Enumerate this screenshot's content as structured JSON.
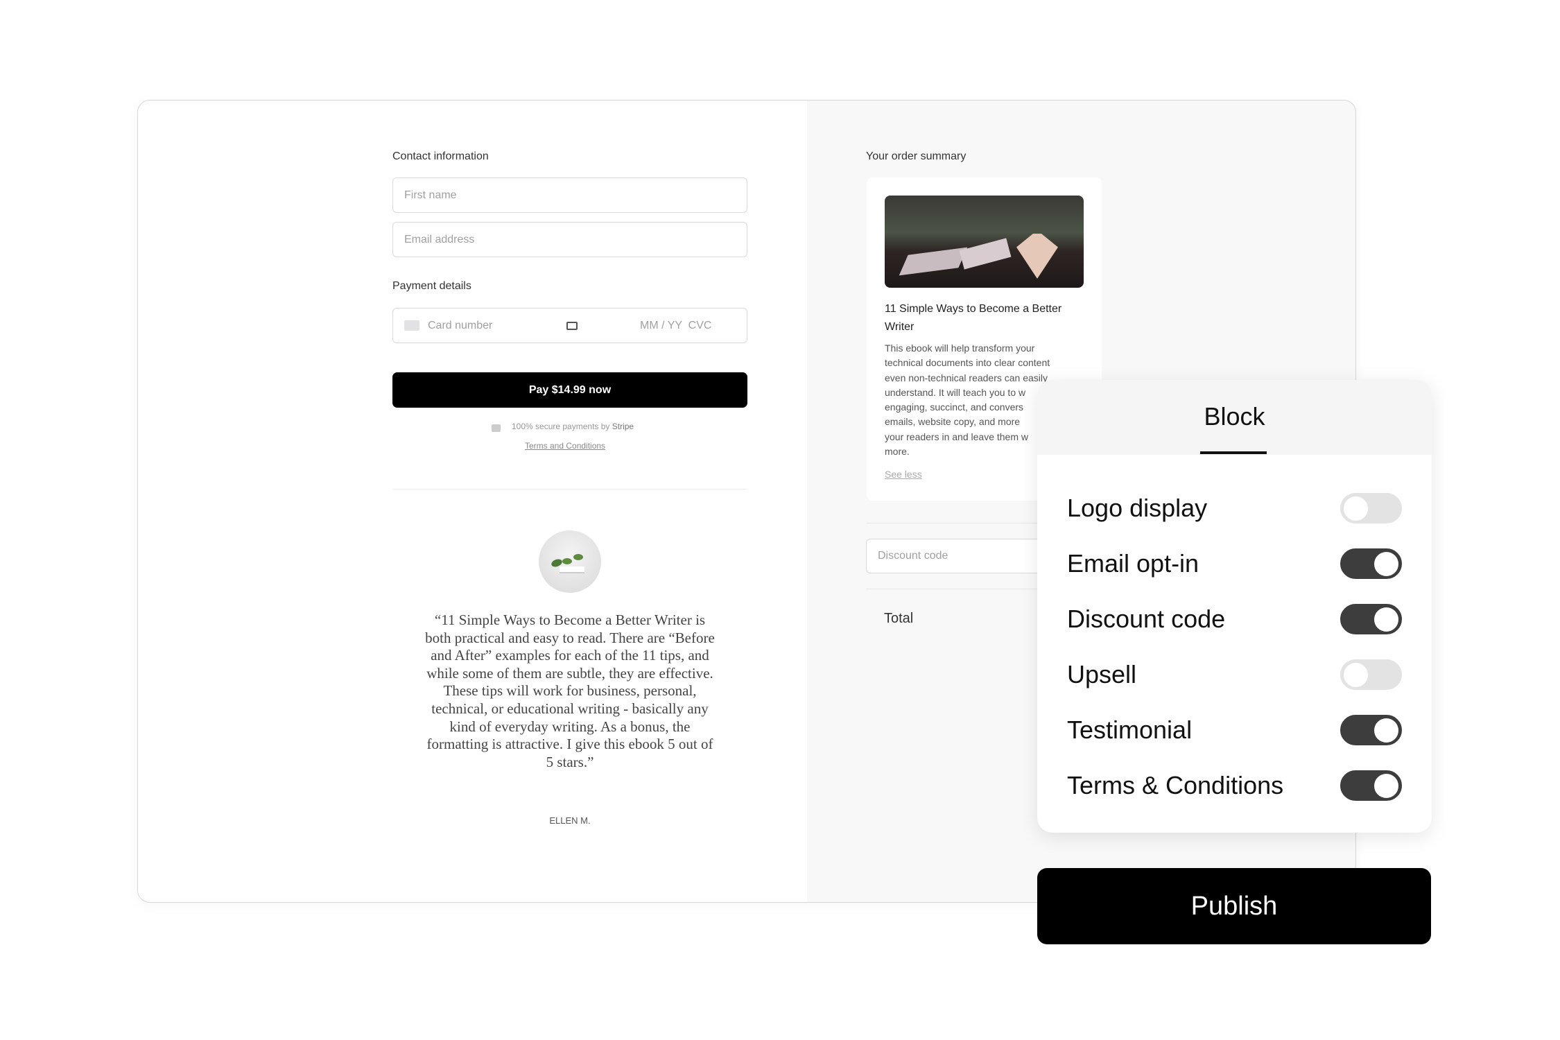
{
  "checkout": {
    "contact_label": "Contact information",
    "first_name_placeholder": "First name",
    "email_placeholder": "Email address",
    "payment_label": "Payment details",
    "card_number_placeholder": "Card number",
    "expiry_cvc_placeholder": "MM / YY  CVC",
    "pay_button": "Pay $14.99 now",
    "secure_text": "100% secure payments by ",
    "secure_brand": "Stripe",
    "terms_link": "Terms and Conditions"
  },
  "testimonial": {
    "quote": "“11 Simple Ways to Become a Better Writer is both practical and easy to read. There are “Before and After” examples for each of the 11 tips, and while some of them are subtle, they are effective. These tips will work for business, personal, technical, or educational writing - basically any kind of everyday writing. As a bonus, the formatting is attractive. I give this ebook 5 out of 5 stars.”",
    "author": "ELLEN M."
  },
  "order": {
    "label": "Your order summary",
    "product_title": "11 Simple Ways to Become a Better Writer",
    "description_lines": [
      "This ebook will help transform your",
      "technical documents into clear content",
      "even non-technical readers can easily",
      "understand. It will teach you to w",
      "engaging, succinct, and convers",
      "emails, website copy, and more",
      "your readers in and leave them w",
      "more."
    ],
    "see_less": "See less",
    "discount_placeholder": "Discount code",
    "total_label": "Total"
  },
  "panel": {
    "tab": "Block",
    "toggles": [
      {
        "label": "Logo display",
        "on": false
      },
      {
        "label": "Email opt-in",
        "on": true
      },
      {
        "label": "Discount code",
        "on": true
      },
      {
        "label": "Upsell",
        "on": false
      },
      {
        "label": "Testimonial",
        "on": true
      },
      {
        "label": "Terms & Conditions",
        "on": true
      }
    ],
    "publish": "Publish"
  },
  "colors": {
    "toggle_on": "#3d3d3d",
    "toggle_off": "#e3e3e3",
    "primary": "#000000"
  }
}
